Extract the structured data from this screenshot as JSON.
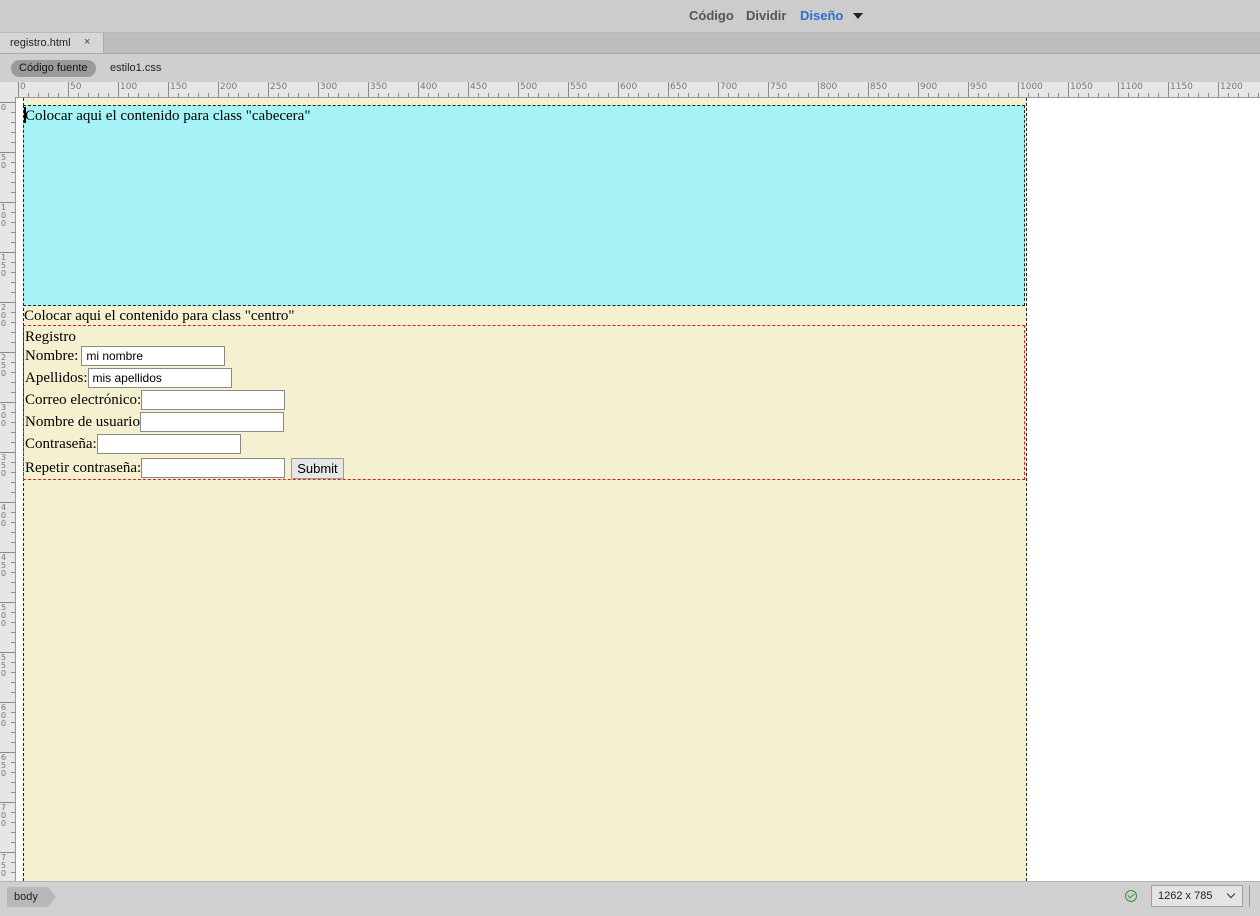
{
  "toolbar": {
    "views": [
      "Código",
      "Dividir",
      "Diseño"
    ],
    "active_view": "Diseño"
  },
  "document_tab": {
    "filename": "registro.html",
    "close_glyph": "×"
  },
  "related_files": {
    "source": "Código fuente",
    "css": "estilo1.css"
  },
  "rulers": {
    "horizontal_labels": [
      "0",
      "50",
      "100",
      "150",
      "200",
      "250",
      "300",
      "350",
      "400",
      "450",
      "500",
      "550",
      "600",
      "650",
      "700",
      "750",
      "800",
      "850",
      "900",
      "950",
      "1000",
      "1050",
      "1100",
      "1150",
      "1200"
    ],
    "vertical_labels": [
      "0",
      "50",
      "100",
      "150",
      "200",
      "250",
      "300",
      "350",
      "400",
      "450",
      "500",
      "550",
      "600",
      "650",
      "700",
      "750"
    ]
  },
  "design": {
    "cabecera_text": "Colocar aqui el contenido para class \"cabecera\"",
    "centro_text": "Colocar aqui el contenido para class \"centro\"",
    "form": {
      "title": "Registro",
      "nombre_label": "Nombre:",
      "nombre_value": "mi nombre",
      "apellidos_label": "Apellidos:",
      "apellidos_value": "mis apellidos",
      "correo_label": "Correo electrónico:",
      "usuario_label": "Nombre de usuario",
      "contrasena_label": "Contraseña:",
      "repetir_label": "Repetir contraseña:",
      "submit_label": "Submit"
    },
    "colors": {
      "cabecera_bg": "#a5f3f6",
      "centro_bg": "#f5f1d0"
    }
  },
  "statusbar": {
    "tag": "body",
    "viewport_size": "1262 x 785"
  }
}
